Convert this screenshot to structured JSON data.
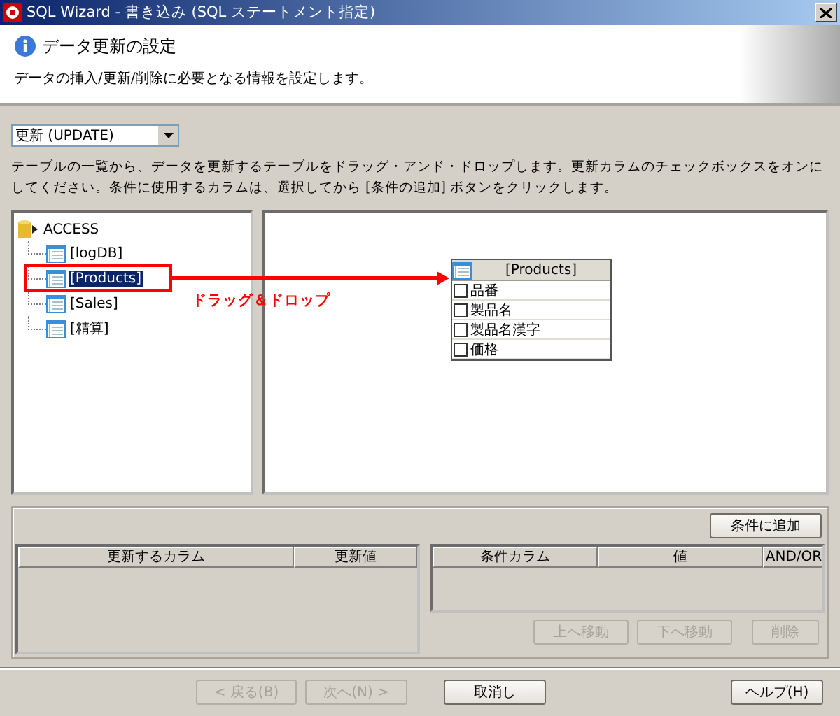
{
  "window": {
    "title": "SQL Wizard - 書き込み (SQL ステートメント指定)"
  },
  "header": {
    "title": "データ更新の設定",
    "description": "データの挿入/更新/削除に必要となる情報を設定します。"
  },
  "operation": {
    "value": "更新 (UPDATE)"
  },
  "instructions": "テーブルの一覧から、データを更新するテーブルをドラッグ・アンド・ドロップします。更新カラムのチェックボックスをオンにしてください。条件に使用するカラムは、選択してから [条件の追加] ボタンをクリックします。",
  "tree": {
    "label": "ACCESS",
    "children": [
      {
        "label": "[logDB]",
        "selected": false
      },
      {
        "label": "[Products]",
        "selected": true
      },
      {
        "label": "[Sales]",
        "selected": false
      },
      {
        "label": "[精算]",
        "selected": false
      }
    ]
  },
  "annotation": {
    "label": "ドラッグ＆ドロップ"
  },
  "canvas_table": {
    "title": "[Products]",
    "columns": [
      {
        "name": "品番",
        "checked": false
      },
      {
        "name": "製品名",
        "checked": false
      },
      {
        "name": "製品名漢字",
        "checked": false
      },
      {
        "name": "価格",
        "checked": false
      }
    ]
  },
  "add_condition_button": {
    "label": "条件に追加",
    "disabled": false
  },
  "update_table": {
    "columns": [
      "更新するカラム",
      "更新値"
    ]
  },
  "condition_table": {
    "columns": [
      "条件カラム",
      "値",
      "AND/OR"
    ]
  },
  "condition_buttons": [
    {
      "label": "上へ移動",
      "disabled": true
    },
    {
      "label": "下へ移動",
      "disabled": true
    },
    {
      "label": "削除",
      "disabled": true
    }
  ],
  "footer_buttons": [
    {
      "label": "< 戻る(B)",
      "disabled": true
    },
    {
      "label": "次へ(N) >",
      "disabled": true
    },
    {
      "label": "取消し",
      "disabled": false
    },
    {
      "label": "ヘルプ(H)",
      "disabled": false
    }
  ]
}
